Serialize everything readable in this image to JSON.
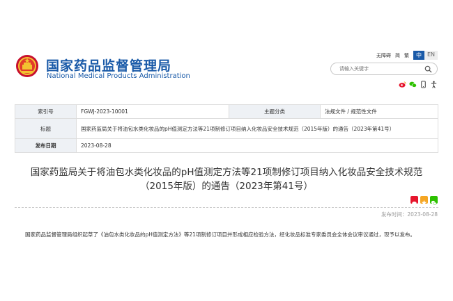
{
  "brand": {
    "name_cn": "国家药品监督管理局",
    "name_en": "National Medical Products Administration"
  },
  "topbar": {
    "accessibility": "无障碍",
    "simplified": "简",
    "traditional": "繁",
    "lang_cn": "中",
    "lang_en": "EN"
  },
  "search": {
    "placeholder": "请输入关键字"
  },
  "meta": {
    "index_label": "索引号",
    "index_value": "FGWJ-2023-10001",
    "topic_label": "主题分类",
    "topic_value": "法规文件 / 规范性文件",
    "title_label": "标题",
    "title_value": "国家药监局关于将油包水类化妆品的pH值测定方法等21项制修订项目纳入化妆品安全技术规范（2015年版）的通告（2023年第41号）",
    "date_label": "发布日期",
    "date_value": "2023-08-28"
  },
  "article": {
    "title": "国家药监局关于将油包水类化妆品的pH值测定方法等21项制修订项目纳入化妆品安全技术规范（2015年版）的通告（2023年第41号）",
    "publish_label": "发布时间：2023-08-28",
    "body": "国家药品监督管理局组织起草了《油包水类化妆品的pH值测定方法》等21项制修订项目并形成相应检验方法，经化妆品标准专家委员会全体会议审议通过，现予以发布。"
  },
  "colors": {
    "brand_blue": "#1a5aa8",
    "weibo": "#e6162d",
    "qzone": "#f5a623",
    "wechat": "#2dc100"
  }
}
